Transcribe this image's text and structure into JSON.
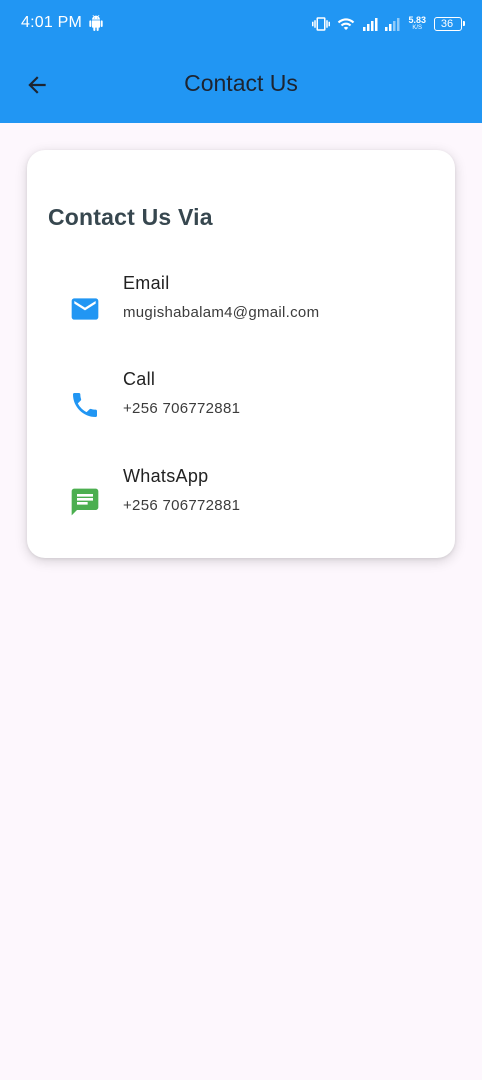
{
  "status_bar": {
    "time": "4:01 PM",
    "net_speed": "5.83",
    "net_speed_unit": "K/S",
    "battery": "36"
  },
  "app_bar": {
    "title": "Contact Us",
    "back_icon": "arrow-back-icon",
    "background_color": "#2196f3"
  },
  "card": {
    "heading": "Contact Us Via",
    "items": [
      {
        "icon": "email-icon",
        "icon_color": "#2196f3",
        "title": "Email",
        "detail": "mugishabalam4@gmail.com"
      },
      {
        "icon": "phone-icon",
        "icon_color": "#2196f3",
        "title": "Call",
        "detail": "+256 706772881"
      },
      {
        "icon": "message-icon",
        "icon_color": "#4caf50",
        "title": "WhatsApp",
        "detail": "+256 706772881"
      }
    ]
  }
}
